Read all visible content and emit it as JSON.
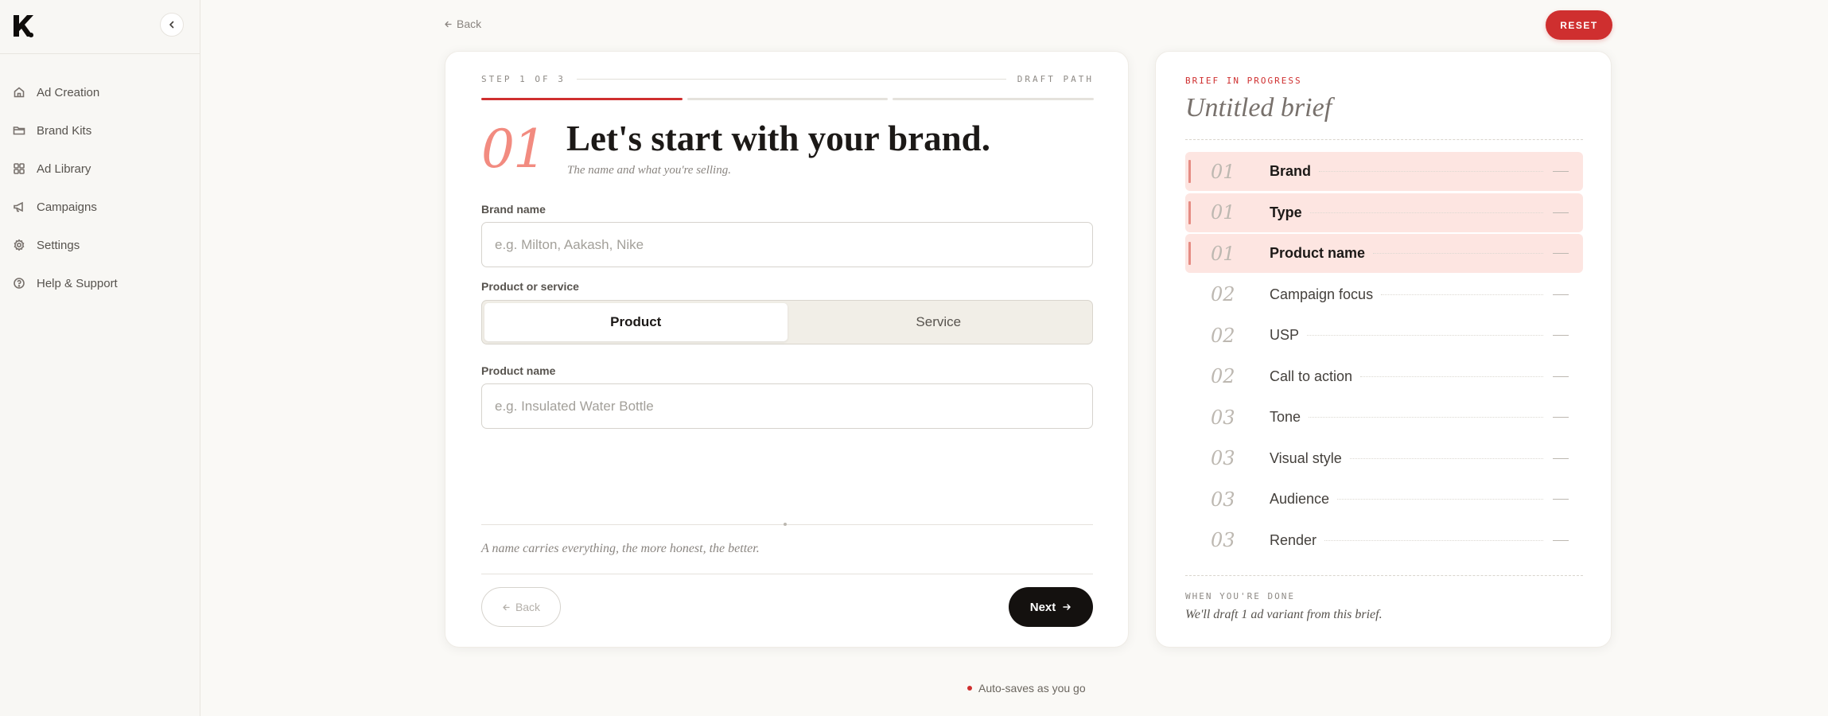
{
  "sidebar": {
    "logo_icon": "k-logo-icon",
    "items": [
      {
        "label": "Ad Creation",
        "icon": "home-icon"
      },
      {
        "label": "Brand Kits",
        "icon": "folder-icon"
      },
      {
        "label": "Ad Library",
        "icon": "grid-icon"
      },
      {
        "label": "Campaigns",
        "icon": "megaphone-icon"
      },
      {
        "label": "Settings",
        "icon": "gear-icon"
      },
      {
        "label": "Help & Support",
        "icon": "help-icon"
      }
    ]
  },
  "topbar": {
    "back_label": "Back",
    "reset_label": "RESET"
  },
  "wizard": {
    "step_label": "STEP 1 OF 3",
    "path_label": "DRAFT PATH",
    "progress_active_segments": 1,
    "progress_total_segments": 3,
    "step_number": "01",
    "headline": "Let's start with your brand.",
    "subhead": "The name and what you're selling.",
    "brand_name": {
      "label": "Brand name",
      "placeholder": "e.g. Milton, Aakash, Nike",
      "value": ""
    },
    "product_or_service": {
      "label": "Product or service",
      "options": [
        "Product",
        "Service"
      ],
      "selected": "Product"
    },
    "product_name": {
      "label": "Product name",
      "placeholder": "e.g. Insulated Water Bottle",
      "value": ""
    },
    "tip": "A name carries everything, the more honest, the better.",
    "back_button": "Back",
    "next_button": "Next"
  },
  "brief": {
    "eyebrow": "BRIEF IN PROGRESS",
    "title": "Untitled brief",
    "items": [
      {
        "num": "01",
        "label": "Brand",
        "done": true,
        "value": "—"
      },
      {
        "num": "01",
        "label": "Type",
        "done": true,
        "value": "—"
      },
      {
        "num": "01",
        "label": "Product name",
        "done": true,
        "value": "—"
      },
      {
        "num": "02",
        "label": "Campaign focus",
        "done": false,
        "value": "—"
      },
      {
        "num": "02",
        "label": "USP",
        "done": false,
        "value": "—"
      },
      {
        "num": "02",
        "label": "Call to action",
        "done": false,
        "value": "—"
      },
      {
        "num": "03",
        "label": "Tone",
        "done": false,
        "value": "—"
      },
      {
        "num": "03",
        "label": "Visual style",
        "done": false,
        "value": "—"
      },
      {
        "num": "03",
        "label": "Audience",
        "done": false,
        "value": "—"
      },
      {
        "num": "03",
        "label": "Render",
        "done": false,
        "value": "—"
      }
    ],
    "footer_label": "WHEN YOU'RE DONE",
    "footer_text": "We'll draft 1 ad variant from this brief."
  },
  "autosave_text": "Auto-saves as you go",
  "colors": {
    "accent": "#cf2f2f",
    "highlight": "#fde5e1",
    "step_number": "#f28b80",
    "primary_button": "#14110f"
  }
}
